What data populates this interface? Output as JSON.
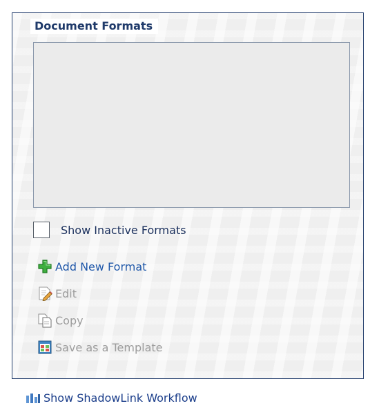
{
  "panel": {
    "legend": "Document Formats"
  },
  "formats_list": {
    "items": []
  },
  "show_inactive": {
    "label": "Show Inactive Formats",
    "checked": false
  },
  "actions": {
    "add_new": {
      "label": "Add New Format",
      "icon": "add-plus-icon",
      "enabled": true
    },
    "edit": {
      "label": "Edit",
      "icon": "edit-document-icon",
      "enabled": false
    },
    "copy": {
      "label": "Copy",
      "icon": "copy-document-icon",
      "enabled": false
    },
    "save_template": {
      "label": "Save as a Template",
      "icon": "template-icon",
      "enabled": false
    }
  },
  "footer": {
    "workflow_link": "Show ShadowLink Workflow",
    "icon": "workflow-icon"
  },
  "colors": {
    "border": "#1f3a6a",
    "link": "#1f57a8",
    "disabled_text": "#9c9c9c",
    "add_icon": "#3fae3f"
  }
}
